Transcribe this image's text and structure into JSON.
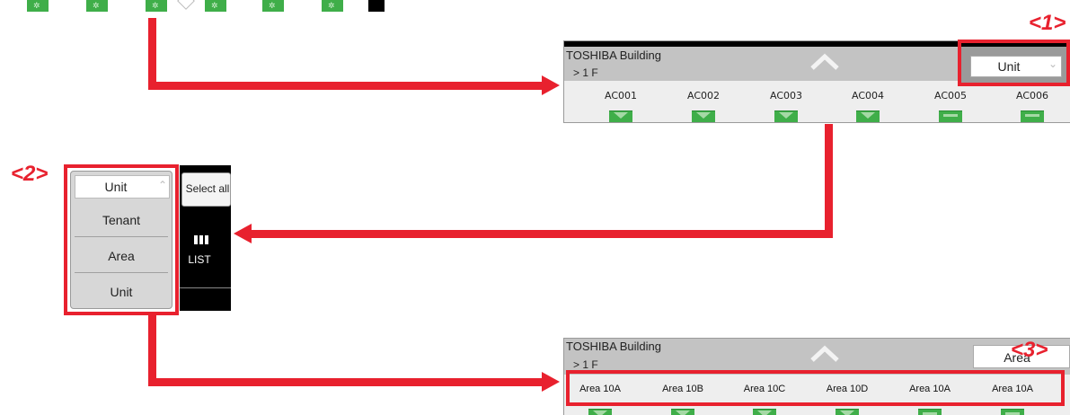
{
  "callouts": {
    "one": "<1>",
    "two": "<2>",
    "three": "<3>"
  },
  "top_panel": {
    "title": "TOSHIBA Building",
    "floor": "> 1 F",
    "mode_value": "Unit",
    "units": [
      {
        "label": "AC001",
        "state": "down"
      },
      {
        "label": "AC002",
        "state": "down"
      },
      {
        "label": "AC003",
        "state": "down"
      },
      {
        "label": "AC004",
        "state": "down"
      },
      {
        "label": "AC005",
        "state": "bar"
      },
      {
        "label": "AC006",
        "state": "bar"
      }
    ]
  },
  "dropdown": {
    "selected": "Unit",
    "options": [
      "Tenant",
      "Area",
      "Unit"
    ],
    "select_all_label": "Select all",
    "list_label": "LIST"
  },
  "bottom_panel": {
    "title": "TOSHIBA Building",
    "floor": "> 1 F",
    "mode_value": "Area",
    "areas": [
      "Area 10A",
      "Area 10B",
      "Area 10C",
      "Area 10D",
      "Area 10A",
      "Area 10A"
    ]
  },
  "colors": {
    "accent_red": "#e8212e",
    "unit_green": "#3fae49",
    "header_gray": "#c3c3c3"
  }
}
